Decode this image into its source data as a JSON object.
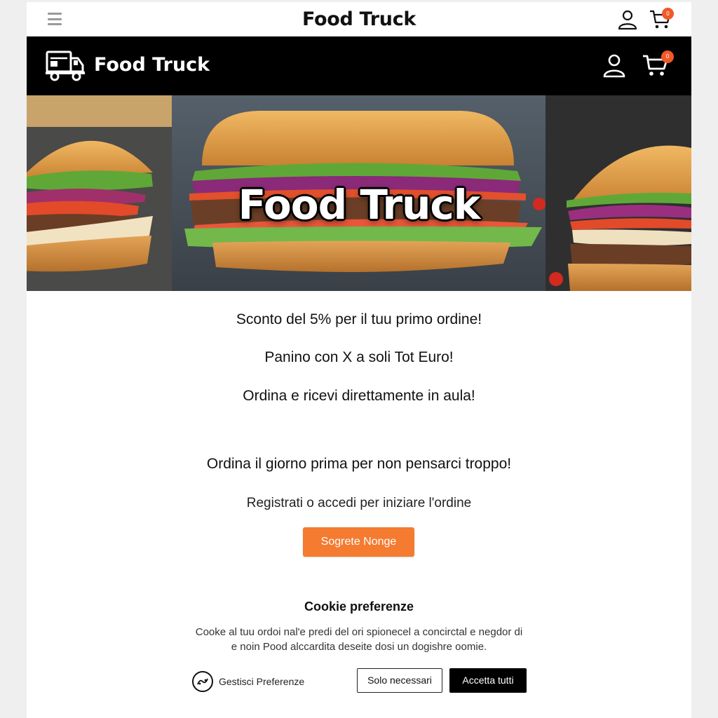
{
  "topbar": {
    "title": "Food Truck",
    "cart_count": "0",
    "menu_icon": "hamburger-icon",
    "user_icon": "user-icon",
    "cart_icon": "cart-icon"
  },
  "navbar": {
    "brand": "Food Truck",
    "cart_count": "0",
    "logo_icon": "truck-icon",
    "user_icon": "user-icon",
    "cart_icon": "cart-icon"
  },
  "hero": {
    "title": "Food Truck"
  },
  "promos": [
    "Sconto del 5% per il tuu primo ordine!",
    "Panino con X a soli Tot Euro!",
    "Ordina e ricevi direttamente in aula!",
    "Ordina il giorno prima per non pensarci troppo!"
  ],
  "register": {
    "text": "Registrati o accedi per iniziare l'ordine",
    "button": "Sogrete Nonge"
  },
  "cookie": {
    "title": "Cookie preferenze",
    "text_line1": "Cooke al tuu ordoi nal'e predi del ori spionecel a concirctal e negdor di",
    "text_line2": "e noin Pood alccardita deseite dosi un dogishre oomie.",
    "manage_label": "Gestisci Preferenze",
    "necessary_label": "Solo necessari",
    "accept_label": "Accetta tutti"
  },
  "colors": {
    "accent": "#f47b30",
    "badge": "#f05a28",
    "navbar": "#000000"
  }
}
